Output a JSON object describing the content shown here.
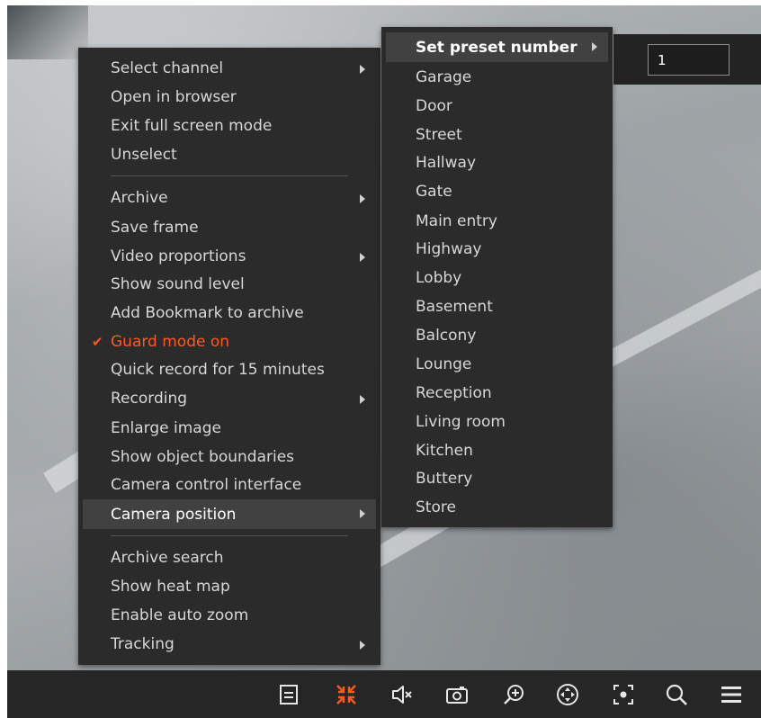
{
  "main_menu": {
    "items": [
      {
        "label": "Select channel",
        "submenu": true
      },
      {
        "label": "Open in browser",
        "submenu": false
      },
      {
        "label": "Exit full screen mode",
        "submenu": false
      },
      {
        "label": "Unselect",
        "submenu": false
      },
      {
        "label": "Archive",
        "submenu": true
      },
      {
        "label": "Save frame",
        "submenu": false
      },
      {
        "label": "Video proportions",
        "submenu": true
      },
      {
        "label": "Show sound level",
        "submenu": false
      },
      {
        "label": "Add Bookmark to archive",
        "submenu": false
      },
      {
        "label": "Guard mode on",
        "submenu": false,
        "checked": true,
        "color": "#ff5a1f"
      },
      {
        "label": "Quick record for 15 minutes",
        "submenu": false
      },
      {
        "label": "Recording",
        "submenu": true
      },
      {
        "label": "Enlarge image",
        "submenu": false
      },
      {
        "label": "Show object boundaries",
        "submenu": false
      },
      {
        "label": "Camera control interface",
        "submenu": false
      },
      {
        "label": "Camera position",
        "submenu": true,
        "highlighted": true
      },
      {
        "label": "Archive search",
        "submenu": false
      },
      {
        "label": "Show heat map",
        "submenu": false
      },
      {
        "label": "Enable auto zoom",
        "submenu": false
      },
      {
        "label": "Tracking",
        "submenu": true
      }
    ],
    "check_glyph": "✔"
  },
  "sub_menu": {
    "header": {
      "label": "Set preset number",
      "submenu": true
    },
    "presets": [
      "Garage",
      "Door",
      "Street",
      "Hallway",
      "Gate",
      "Main entry",
      "Highway",
      "Lobby",
      "Basement",
      "Balcony",
      "Lounge",
      "Reception",
      "Living room",
      "Kitchen",
      "Buttery",
      "Store"
    ]
  },
  "preset_input": {
    "value": "1"
  },
  "toolbar": {
    "icons": [
      "layout-icon",
      "exit-fullscreen-icon",
      "mute-icon",
      "snapshot-icon",
      "zoom-in-icon",
      "ptz-control-icon",
      "focus-icon",
      "search-icon",
      "menu-icon"
    ],
    "accent_color": "#ff5a1f"
  }
}
